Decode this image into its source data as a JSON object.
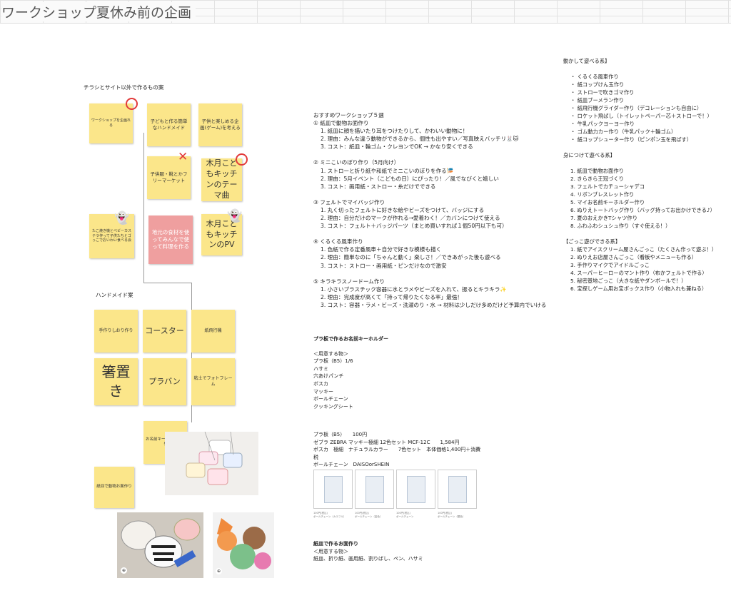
{
  "title": "ワークショップ夏休み前の企画",
  "left": {
    "section1_label": "チラシとサイト以外で作るもの案",
    "section2_label": "ハンドメイド案",
    "notes": [
      "ワークショップを企画れる",
      "子どもと作る簡単なハンドメイド",
      "子供と楽しめる企画(ゲーム)を考える",
      "子供服・靴とかフリーマーケット",
      "木月こどもキッチンのテーマ曲",
      "たこ焼き機とベビーカステラ作って子供たちとゴっこでおいわい食べる会",
      "地元の食材を使ってみんなで使って料理を作る",
      "木月こどもキッチンのPV",
      "手作りしおり作り",
      "コースター",
      "紙飛行機",
      "箸置き",
      "プラバン",
      "粘土でフォトフレーム",
      "お名前キーホルダー作り",
      "紙皿で動物お面作り"
    ],
    "ghost_icon": "ghost-emoji"
  },
  "middle": {
    "recommend_title": "おすすめワークショップ５選",
    "recommend": [
      {
        "heading": "① 紙皿で動物お面作り",
        "lines": [
          "1. 紙皿に顔を描いたり耳をつけたりして、かわいい動物に！",
          "2. 理由：みんな違う動物ができるから、個性も出やすい／写真映えバッチリ🐰🐱",
          "3. コスト：紙皿・輪ゴム・クレヨンでOK → かなり安くできる"
        ]
      },
      {
        "heading": "② ミニこいのぼり作り（5月向け）",
        "lines": [
          "1. ストローと折り紙や和紙でミニこいのぼりを作る🎏",
          "2. 理由：5月イベント（こどもの日）にぴったり！／風でなびくと嬉しい",
          "3. コスト：画用紙・ストロー・糸だけでできる"
        ]
      },
      {
        "heading": "③ フェルトでマイバッジ作り",
        "lines": [
          "1. 丸く切ったフェルトに好きな絵やビーズをつけて、バッジにする",
          "2. 理由：自分だけのマークが作れる→愛着わく！／カバンにつけて使える",
          "3. コスト：フェルト＋バッジパーツ（まとめ買いすれば１個50円以下も可）"
        ]
      },
      {
        "heading": "④ くるくる風車作り",
        "lines": [
          "1. 色紙で作る定番風車＋自分で好きな模様も描く",
          "2. 理由：簡単なのに「ちゃんと動く」楽しさ！／できあがった後も遊べる",
          "3. コスト：ストロー・画用紙・ピンだけなので激安"
        ]
      },
      {
        "heading": "⑤ キラキラスノードーム作り",
        "lines": [
          "1. 小さいプラスチック容器に水とラメやビーズを入れて、振るとキラキラ✨",
          "2. 理由：完成度が高くて「持って帰りたくなる率」最強！",
          "3. コスト：容器・ラメ・ビーズ・洗濯のり・水 → 材料は少しだけ多めだけど予算内でいける"
        ]
      }
    ],
    "keyholder_title": "プラ板で作るお名前キーホルダー",
    "materials_title": "＜用意する物＞",
    "materials": [
      "プラ板（B5）1/6",
      "ハサミ",
      "穴あけパンチ",
      "ボスカ",
      "マッキー",
      "ボールチェーン",
      "クッキングシート"
    ],
    "prices": [
      "プラ板（B5）　　100円",
      "ゼブラ ZEBRA マッキー極細 12色セット MCF-12C　　1,584円",
      "ポスカ　極細　ナチュラルカラー　　7色セット　本体価格1,400円＋消費",
      "税",
      "ボールチェーン　DAISOorSHEIN"
    ],
    "products": [
      {
        "price": "100円(税込)",
        "name": "ボールチェーン（カラフル）"
      },
      {
        "price": "100円(税込)",
        "name": "ボールチェーン（金色）"
      },
      {
        "price": "100円(税込)",
        "name": "ボールチェーン"
      },
      {
        "price": "100円(税込)",
        "name": "ボールチェーン（銀色）"
      }
    ],
    "plate_title": "紙皿で作るお面作り",
    "plate_materials_title": "＜用意する物＞",
    "plate_materials": "紙皿、折り紙、画用紙、割りばし、ペン、ハサミ"
  },
  "right": {
    "move_title": "動かして遊べる系】",
    "move": [
      "・ くるくる風車作り",
      "・ 紙コップけん玉作り",
      "・ ストローで吹きゴマ作り",
      "・ 紙皿ブーメラン作り",
      "・ 紙飛行機グライダー作り（デコレーションも自由に）",
      "・ ロケット飛ばし（トイレットペーパー芯＋ストローで！）",
      "・ 牛乳パックヨーヨー作り",
      "・ ゴム動力カー作り（牛乳パック＋輪ゴム）",
      "・ 紙コップシューター作り（ピンポン玉を飛ばす）"
    ],
    "wear_title": "身につけて遊べる系】",
    "wear": [
      "1. 紙皿で動物お面作り",
      "2. きらきら王冠づくり",
      "3. フェルトでカチューシャデコ",
      "4. リボンブレスレット作り",
      "5. マイお名前キーホルダー作り",
      "6. ぬりえトートバッグ作り（バッグ持ってお出かけできる♪）",
      "7. 夏のおえかきTシャツ作り",
      "8. ふわふわシュシュ作り（すぐ使える！）"
    ],
    "play_title": "【ごっこ遊びできる系】",
    "play": [
      "1. 紙でアイスクリーム屋さんごっこ（たくさん作って遊ぶ！）",
      "2. ぬりえお店屋さんごっこ（看板やメニューも作る）",
      "3. 手作りマイクでアイドルごっこ",
      "4. スーパーヒーローのマント作り（布かフェルトで作る）",
      "5. 秘密基地ごっこ（大きな紙やダンボールで！）",
      "6. 宝探しゲーム用お宝ボックス作り（小物入れも兼ねる）"
    ]
  }
}
